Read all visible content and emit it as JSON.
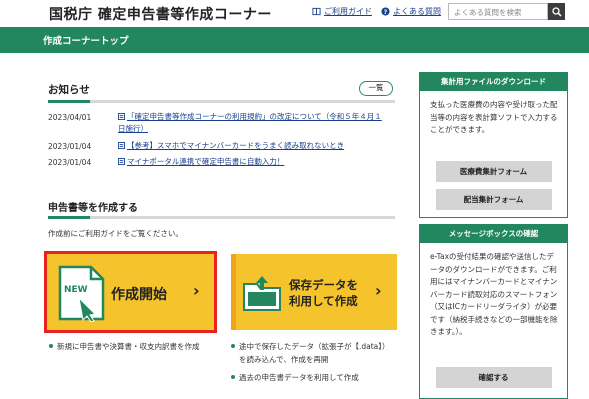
{
  "header": {
    "title": "国税庁 確定申告書等作成コーナー",
    "links": [
      {
        "label": "ご利用ガイド",
        "icon": "book-icon"
      },
      {
        "label": "よくある質問",
        "icon": "question-icon"
      }
    ],
    "search": {
      "placeholder": "よくある質問を検索",
      "icon": "search-icon"
    }
  },
  "nav": {
    "current": "作成コーナートップ"
  },
  "news": {
    "title": "お知らせ",
    "list_button": "一覧",
    "items": [
      {
        "date": "2023/04/01",
        "text": "「確定申告書等作成コーナーの利用規約」の改定について（令和５年４月１日施行）"
      },
      {
        "date": "2023/01/04",
        "text": "【参考】スマホでマイナンバーカードをうまく読み取れないとき"
      },
      {
        "date": "2023/01/04",
        "text": "マイナポータル連携で確定申告書に自動入力！"
      }
    ]
  },
  "create": {
    "title": "申告書等を作成する",
    "guide": "作成前にご利用ガイドをご覧ください。",
    "start_card": {
      "badge": "NEW",
      "label": "作成開始"
    },
    "save_card": {
      "line1": "保存データを",
      "line2": "利用して作成"
    },
    "start_notes": [
      "新規に申告書や決算書・収支内訳書を作成"
    ],
    "save_notes": [
      "途中で保存したデータ（拡張子が【.data】）",
      "を読み込んで、作成を再開",
      "過去の申告書データを利用して作成"
    ]
  },
  "sidebar": {
    "download": {
      "title": "集計用ファイルのダウンロード",
      "desc": "支払った医療費の内容や受け取った配当等の内容を表計算ソフトで入力することができます。",
      "buttons": [
        "医療費集計フォーム",
        "配当集計フォーム"
      ]
    },
    "messagebox": {
      "title": "メッセージボックスの確認",
      "desc": "e-Taxの受付結果の確認や送信したデータのダウンロードができます。ご利用にはマイナンバーカードとマイナンバーカード読取対応のスマートフォン（又はICカードリーダライタ）が必要です（納税手続きなどの一部機能を除きます。）。",
      "button": "確認する"
    }
  },
  "colors": {
    "brand_green": "#22875f",
    "card_yellow": "#f5c32c",
    "highlight_red": "#e8231d",
    "link_blue": "#1a3f8c"
  }
}
